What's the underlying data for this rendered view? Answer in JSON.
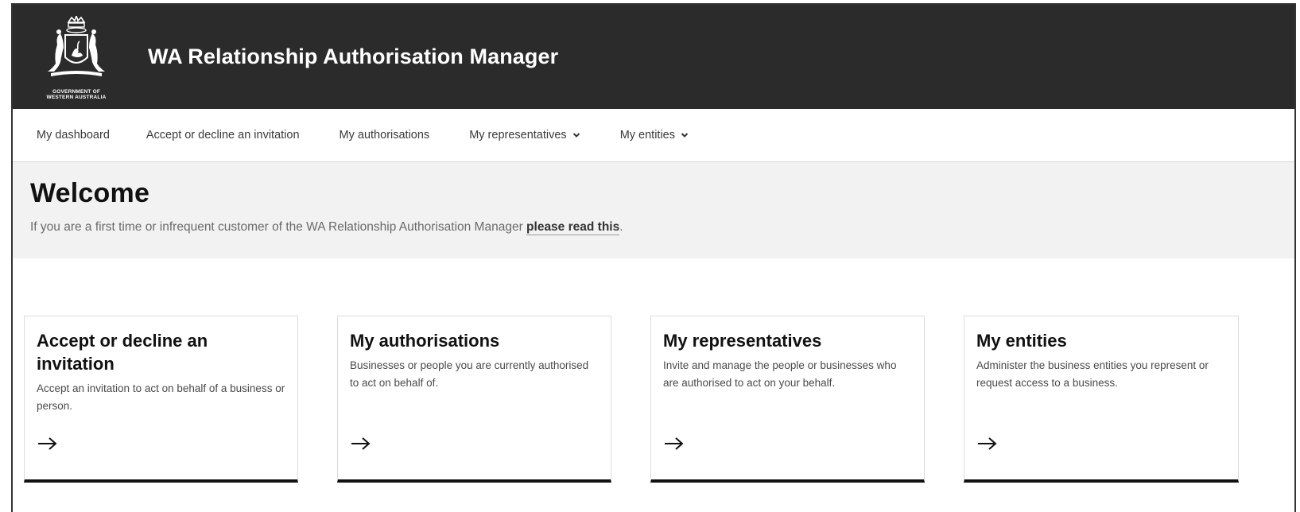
{
  "header": {
    "logo_lines": [
      "GOVERNMENT OF",
      "WESTERN AUSTRALIA"
    ],
    "title": "WA Relationship Authorisation Manager"
  },
  "nav": {
    "items": [
      {
        "label": "My dashboard",
        "dropdown": false
      },
      {
        "label": "Accept or decline an invitation",
        "dropdown": false
      },
      {
        "label": "My authorisations",
        "dropdown": false
      },
      {
        "label": "My representatives",
        "dropdown": true
      },
      {
        "label": "My entities",
        "dropdown": true
      }
    ]
  },
  "welcome": {
    "heading": "Welcome",
    "intro_text": "If you are a first time or infrequent customer of the WA Relationship Authorisation Manager ",
    "intro_link": "please read this",
    "intro_end": "."
  },
  "cards": [
    {
      "title": "Accept or decline an invitation",
      "description": "Accept an invitation to act on behalf of a business or person.",
      "icon": "arrow-right-icon"
    },
    {
      "title": "My authorisations",
      "description": "Businesses or people you are currently authorised to act on behalf of.",
      "icon": "arrow-right-icon"
    },
    {
      "title": "My representatives",
      "description": "Invite and manage the people or businesses who are authorised to act on your behalf.",
      "icon": "arrow-right-icon"
    },
    {
      "title": "My entities",
      "description": "Administer the business entities you represent or request access to a business.",
      "icon": "arrow-right-icon"
    }
  ],
  "colors": {
    "header_bg": "#2b2b2b",
    "welcome_bg": "#f2f2f2",
    "card_border_bottom": "#111111"
  }
}
